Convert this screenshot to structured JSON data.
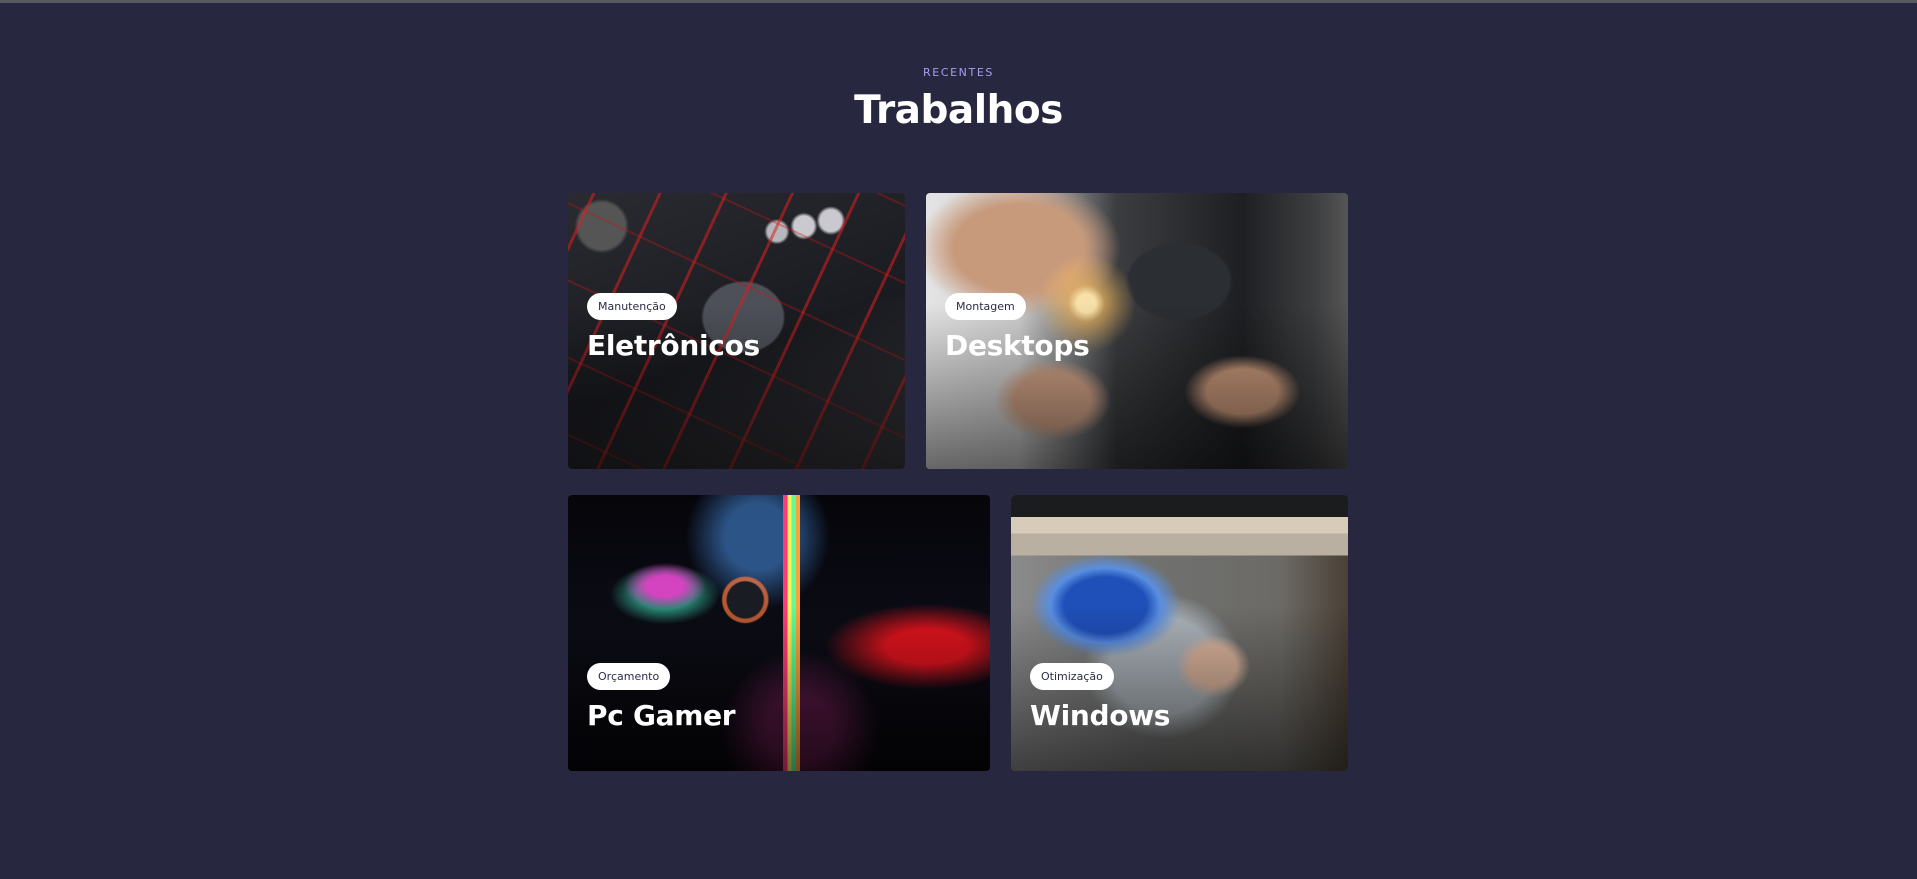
{
  "section": {
    "eyebrow": "RECENTES",
    "heading": "Trabalhos"
  },
  "cards": [
    {
      "tag": "Manutenção",
      "title": "Eletrônicos"
    },
    {
      "tag": "Montagem",
      "title": "Desktops"
    },
    {
      "tag": "Orçamento",
      "title": "Pc Gamer"
    },
    {
      "tag": "Otimização",
      "title": "Windows"
    }
  ],
  "colors": {
    "background": "#272740",
    "eyebrow": "#a99cf0",
    "heading": "#ffffff",
    "tag_background": "#ffffff",
    "tag_text": "#2c2c44"
  }
}
